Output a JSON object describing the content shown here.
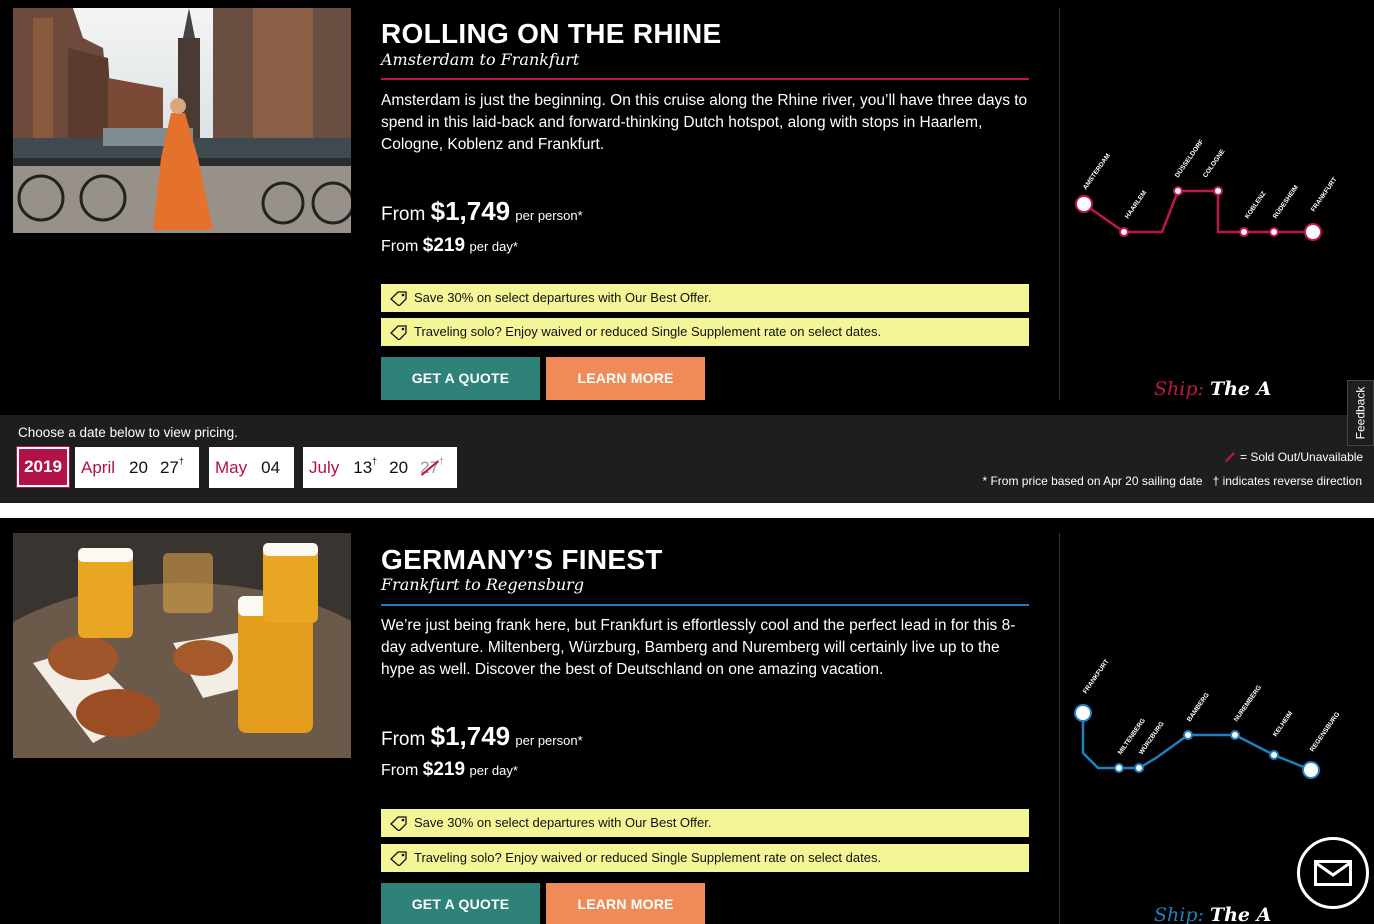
{
  "cruises": [
    {
      "title": "ROLLING ON THE RHINE",
      "subtitle": "Amsterdam to Frankfurt",
      "description": "Amsterdam is just the beginning. On this cruise along the Rhine river, you’ll have three days to spend in this laid-back and forward-thinking Dutch hotspot, along with stops in Haarlem, Cologne, Koblenz and Frankfurt.",
      "price_from_label": "From",
      "price_person": "$1,749",
      "price_person_unit": "per person*",
      "price_day": "$219",
      "price_day_unit": "per day*",
      "offers": [
        "Save 30% on select departures with Our Best Offer.",
        "Traveling solo? Enjoy waived or reduced Single Supplement rate on select dates."
      ],
      "quote_label": "GET A QUOTE",
      "learn_label": "LEARN MORE",
      "ship_label": "Ship:",
      "ship_name": "The A",
      "route_color": "#c2154a",
      "stops": [
        "AMSTERDAM",
        "HAARLEM",
        "DÜSSELDORF",
        "COLOGNE",
        "KOBLENZ",
        "RÜDESHEIM",
        "FRANKFURT"
      ]
    },
    {
      "title": "GERMANY’S FINEST",
      "subtitle": "Frankfurt to Regensburg",
      "description": "We’re just being frank here, but Frankfurt is effortlessly cool and the perfect lead in for this 8-day adventure. Miltenberg, Würzburg, Bamberg and Nuremberg will certainly live up to the hype as well. Discover the best of Deutschland on one amazing vacation.",
      "price_from_label": "From",
      "price_person": "$1,749",
      "price_person_unit": "per person*",
      "price_day": "$219",
      "price_day_unit": "per day*",
      "offers": [
        "Save 30% on select departures with Our Best Offer.",
        "Traveling solo? Enjoy waived or reduced Single Supplement rate on select dates."
      ],
      "quote_label": "GET A QUOTE",
      "learn_label": "LEARN MORE",
      "ship_label": "Ship:",
      "ship_name": "The A",
      "route_color": "#1f7fc0",
      "stops": [
        "FRANKFURT",
        "MILTENBERG",
        "WÜRZBURG",
        "BAMBERG",
        "NUREMBERG",
        "KELHEIM",
        "REGENSBURG"
      ]
    }
  ],
  "dates": {
    "prompt": "Choose a date below to view pricing.",
    "year": "2019",
    "months": [
      {
        "name": "April",
        "days": [
          {
            "d": "20",
            "rev": ""
          },
          {
            "d": "27",
            "rev": "†"
          }
        ]
      },
      {
        "name": "May",
        "days": [
          {
            "d": "04",
            "rev": ""
          }
        ]
      },
      {
        "name": "July",
        "days": [
          {
            "d": "13",
            "rev": "†"
          },
          {
            "d": "20",
            "rev": ""
          },
          {
            "d": "27",
            "rev": "†",
            "sold": true
          }
        ]
      }
    ],
    "legend_sold": "= Sold Out/Unavailable",
    "legend_note": "* From price based on Apr 20 sailing date",
    "legend_reverse": "† indicates reverse direction"
  },
  "feedback_label": "Feedback",
  "icons": [
    "price-tag-icon",
    "envelope-icon"
  ]
}
